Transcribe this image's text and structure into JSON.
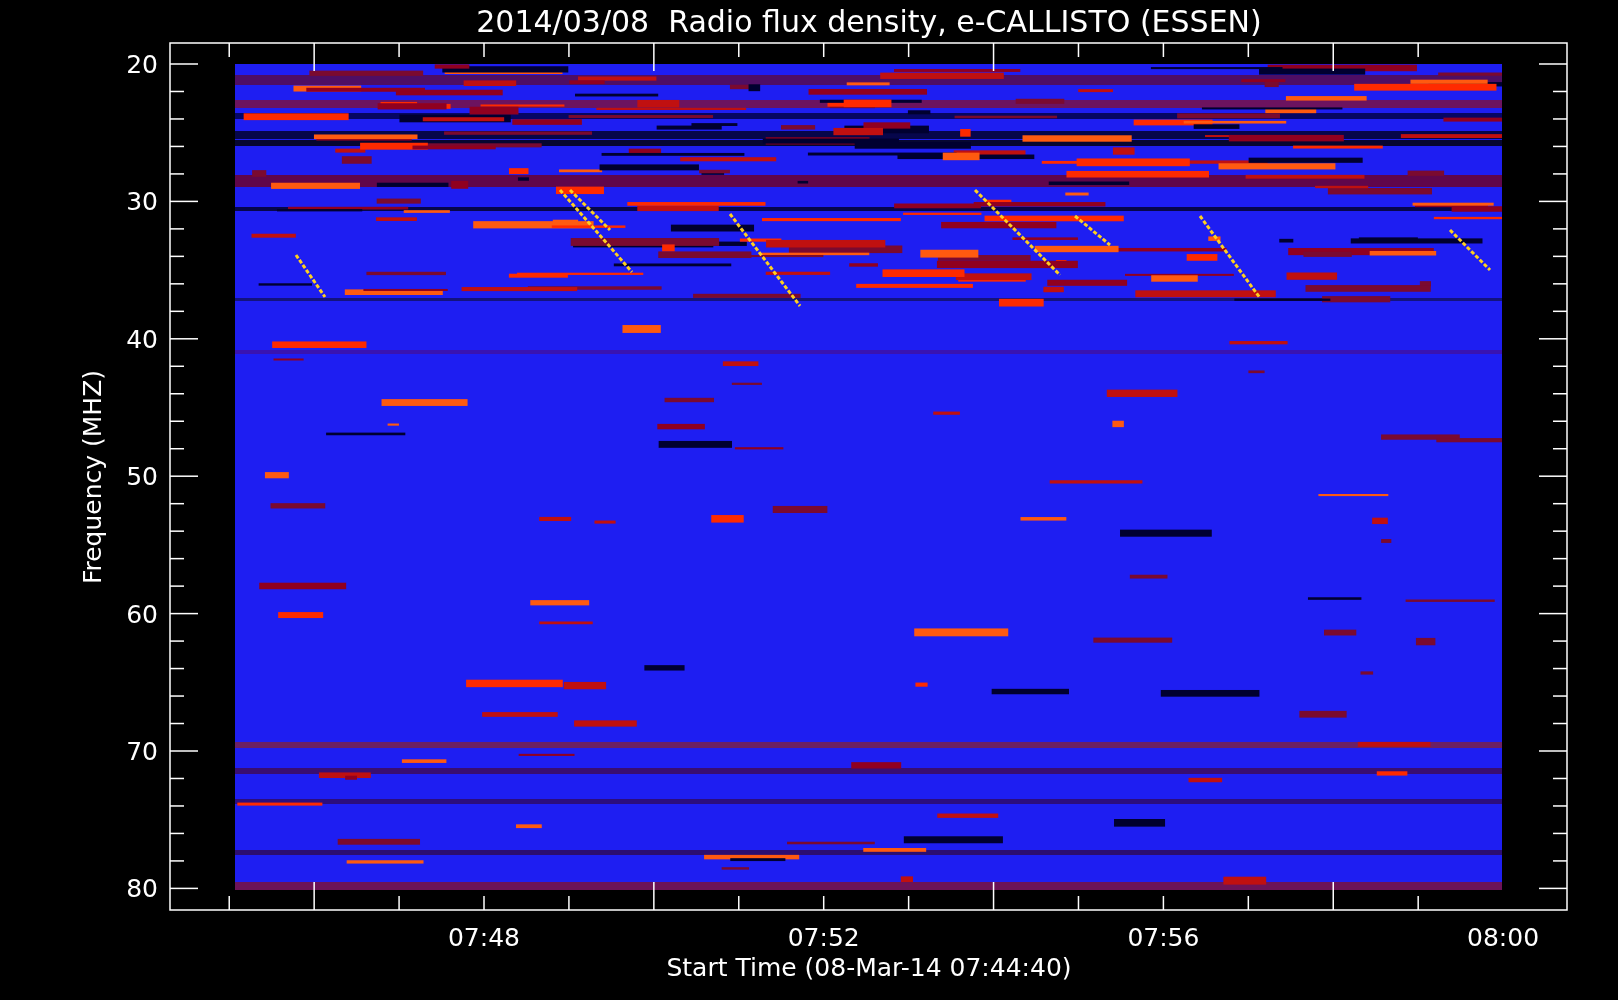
{
  "title": "2014/03/08  Radio flux density, e-CALLISTO (ESSEN)",
  "y_axis": {
    "label": "Frequency (MHZ)",
    "ticks": [
      "20",
      "30",
      "40",
      "50",
      "60",
      "70",
      "80"
    ]
  },
  "x_axis": {
    "label": "Start Time (08-Mar-14 07:44:40)",
    "ticks": [
      "07:48",
      "07:52",
      "07:56",
      "08:00"
    ]
  }
}
